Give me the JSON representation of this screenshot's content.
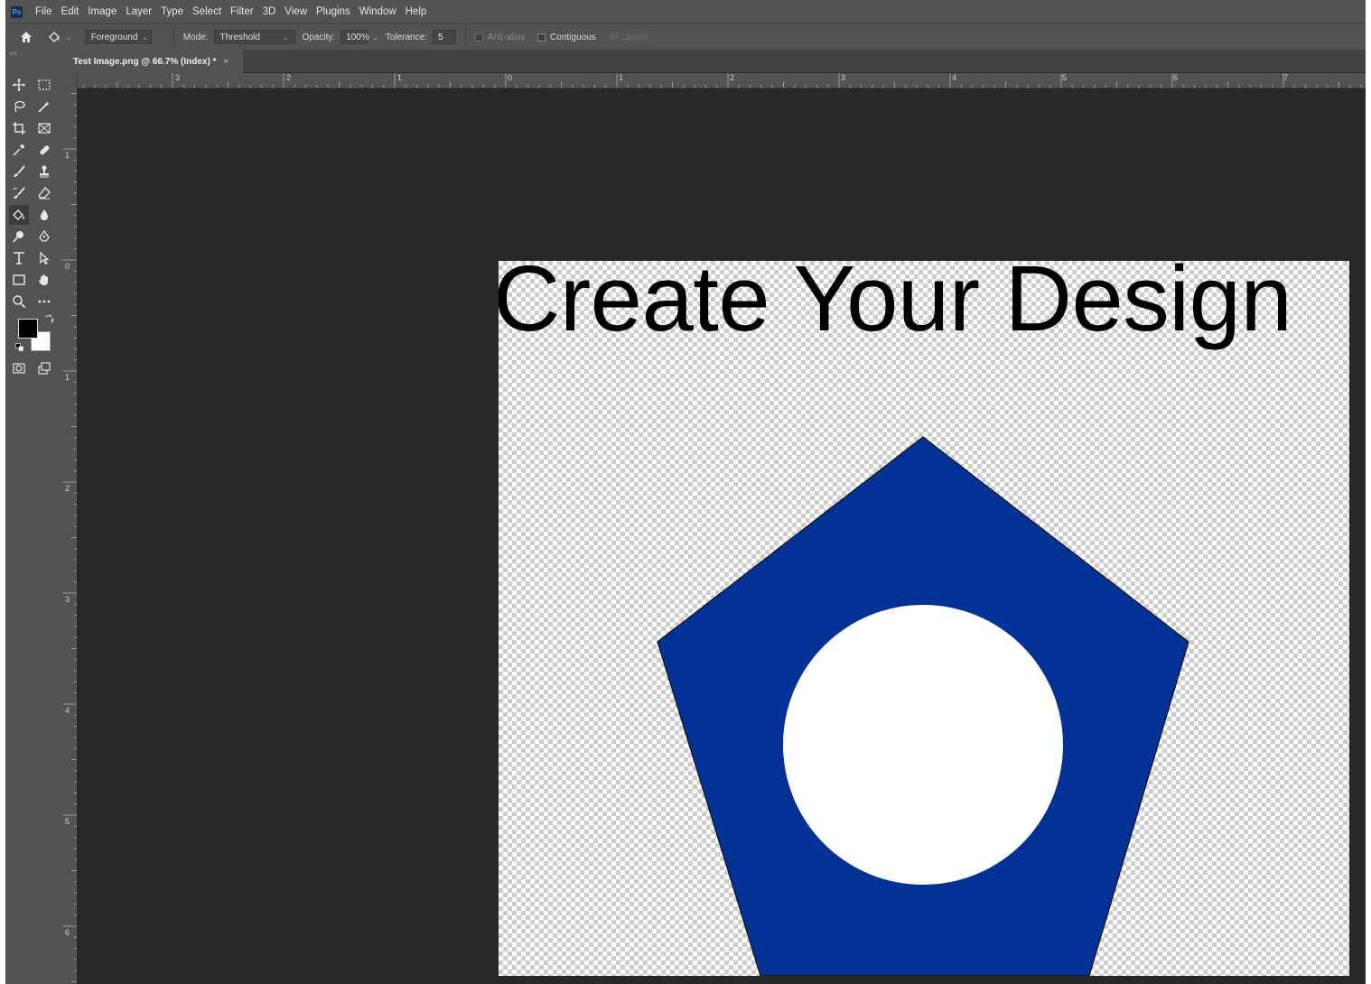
{
  "app": {
    "logo_text": "Ps",
    "menu": [
      "File",
      "Edit",
      "Image",
      "Layer",
      "Type",
      "Select",
      "Filter",
      "3D",
      "View",
      "Plugins",
      "Window",
      "Help"
    ]
  },
  "options_bar": {
    "fill_source": "Foreground",
    "mode_label": "Mode:",
    "mode_value": "Threshold",
    "opacity_label": "Opacity:",
    "opacity_value": "100%",
    "tolerance_label": "Tolerance:",
    "tolerance_value": "5",
    "anti_alias_label": "Anti-alias",
    "contiguous_label": "Contiguous",
    "all_layers_label": "All Layers"
  },
  "collapse_label": "<<",
  "document_tab": {
    "title": "Test Image.png @ 66.7% (Index) *",
    "close_glyph": "×"
  },
  "ruler": {
    "top_labels": [
      "3",
      "2",
      "1",
      "0",
      "1",
      "2",
      "3",
      "4",
      "5",
      "6",
      "7"
    ],
    "left_labels": [
      "1",
      "0",
      "1",
      "2",
      "3",
      "4",
      "5",
      "6"
    ]
  },
  "tools": [
    [
      "move-tool-icon",
      "marquee-tool-icon"
    ],
    [
      "lasso-tool-icon",
      "magic-wand-tool-icon"
    ],
    [
      "crop-tool-icon",
      "frame-tool-icon"
    ],
    [
      "eyedropper-tool-icon",
      "healing-brush-tool-icon"
    ],
    [
      "brush-tool-icon",
      "clone-stamp-tool-icon"
    ],
    [
      "history-brush-tool-icon",
      "eraser-tool-icon"
    ],
    [
      "paint-bucket-tool-icon",
      "blur-tool-icon"
    ],
    [
      "dodge-tool-icon",
      "pen-tool-icon"
    ],
    [
      "type-tool-icon",
      "path-selection-tool-icon"
    ],
    [
      "rectangle-tool-icon",
      "hand-tool-icon"
    ],
    [
      "zoom-tool-icon",
      "more-tools-icon"
    ]
  ],
  "active_tool": "paint-bucket-tool-icon",
  "colors": {
    "foreground": "#000000",
    "background": "#ffffff",
    "pentagon_fill": "#023296",
    "circle_fill": "#ffffff"
  },
  "document": {
    "headline": "Create Your Design"
  }
}
